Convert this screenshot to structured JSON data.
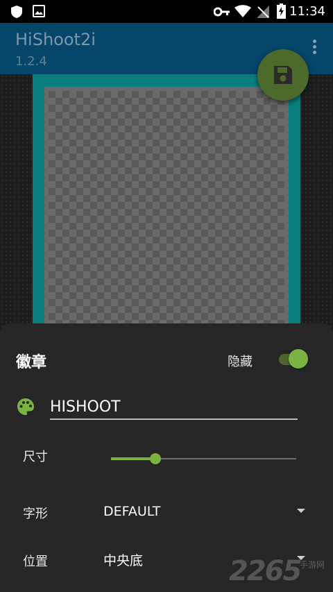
{
  "status_bar": {
    "time": "11:34",
    "icons": [
      "shield-icon",
      "image-icon",
      "key-icon",
      "wifi-icon",
      "no-signal-icon",
      "battery-charging-icon"
    ]
  },
  "app_bar": {
    "title": "HiShoot2i",
    "version": "1.2.4",
    "menu_icon": "more-vert-icon",
    "color": "#06466a"
  },
  "fab": {
    "icon": "save-icon",
    "color": "#4c6b2a"
  },
  "badge_sheet": {
    "title": "徽章",
    "hide_label": "隐藏",
    "hide_toggle_on": true,
    "text_icon": "palette-icon",
    "text_value": "HISHOOT",
    "size_label": "尺寸",
    "size_value": 0.24,
    "font_label": "字形",
    "font_value": "DEFAULT",
    "position_label": "位置",
    "position_value": "中央底",
    "accent_color": "#7ab342"
  },
  "watermark": {
    "text": "2265",
    "sub": "手游网"
  }
}
